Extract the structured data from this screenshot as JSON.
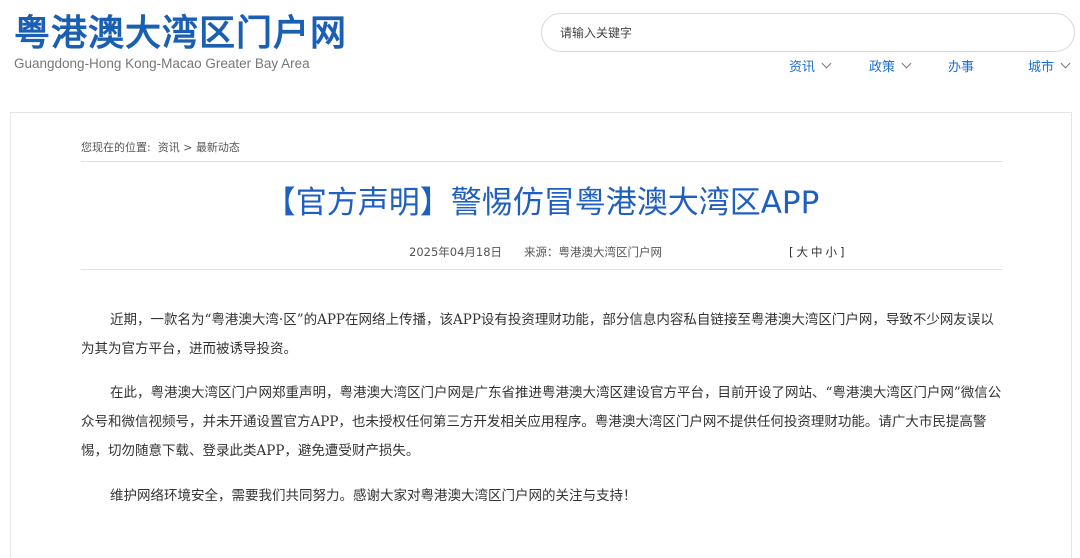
{
  "header": {
    "logo_title": "粤港澳大湾区门户网",
    "logo_subtitle": "Guangdong-Hong Kong-Macao Greater Bay Area",
    "search_placeholder": "请输入关键字"
  },
  "nav": {
    "items": [
      {
        "label": "资讯",
        "has_dropdown": true
      },
      {
        "label": "政策",
        "has_dropdown": true
      },
      {
        "label": "办事",
        "has_dropdown": false
      },
      {
        "label": "城市",
        "has_dropdown": true
      }
    ]
  },
  "breadcrumb": {
    "prefix": "您现在的位置:",
    "level1": "资讯",
    "separator": ">",
    "level2": "最新动态"
  },
  "article": {
    "title": "【官方声明】警惕仿冒粤港澳大湾区APP",
    "date": "2025年04月18日",
    "source": "来源：粤港澳大湾区门户网",
    "font_size_label_open": "[",
    "font_size_large": "大",
    "font_size_medium": "中",
    "font_size_small": "小",
    "font_size_label_close": "]",
    "paragraphs": [
      "近期，一款名为“粤港澳大湾·区”的APP在网络上传播，该APP设有投资理财功能，部分信息内容私自链接至粤港澳大湾区门户网，导致不少网友误以为其为官方平台，进而被诱导投资。",
      "在此，粤港澳大湾区门户网郑重声明，粤港澳大湾区门户网是广东省推进粤港澳大湾区建设官方平台，目前开设了网站、“粤港澳大湾区门户网”微信公众号和微信视频号，并未开通设置官方APP，也未授权任何第三方开发相关应用程序。粤港澳大湾区门户网不提供任何投资理财功能。请广大市民提高警惕，切勿随意下载、登录此类APP，避免遭受财产损失。",
      "维护网络环境安全，需要我们共同努力。感谢大家对粤港澳大湾区门户网的关注与支持！"
    ]
  },
  "colors": {
    "brand_blue": "#1a5fb4",
    "title_blue": "#1f5fbf",
    "nav_blue": "#1a6fd1"
  }
}
